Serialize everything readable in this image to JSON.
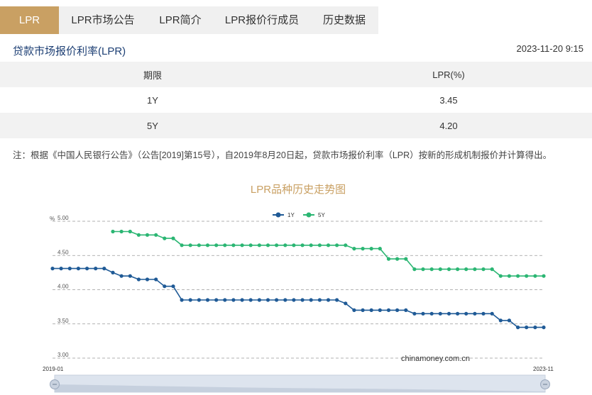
{
  "tabs": [
    {
      "label": "LPR",
      "active": true
    },
    {
      "label": "LPR市场公告",
      "active": false
    },
    {
      "label": "LPR简介",
      "active": false
    },
    {
      "label": "LPR报价行成员",
      "active": false
    },
    {
      "label": "历史数据",
      "active": false
    }
  ],
  "section_title": "贷款市场报价利率(LPR)",
  "timestamp": "2023-11-20 9:15",
  "table": {
    "headers": [
      "期限",
      "LPR(%)"
    ],
    "rows": [
      {
        "term": "1Y",
        "rate": "3.45"
      },
      {
        "term": "5Y",
        "rate": "4.20"
      }
    ]
  },
  "note": "注：根据《中国人民银行公告》（公告[2019]第15号），自2019年8月20日起，贷款市场报价利率（LPR）按新的形成机制报价并计算得出。",
  "colors": {
    "accent": "#c9a063",
    "title_blue": "#1d3f74",
    "series_1y": "#1f5a96",
    "series_5y": "#2bb673"
  },
  "chart_data": {
    "type": "line",
    "title": "LPR品种历史走势图",
    "ylabel": "%",
    "ylim": [
      3.0,
      5.0
    ],
    "yticks": [
      "5.00",
      "4.50",
      "4.00",
      "3.50",
      "3.00"
    ],
    "x_start_label": "2019-01",
    "x_end_label": "2023-11",
    "watermark": "chinamoney.com.cn",
    "legend_position": "top-center",
    "grid": true,
    "series": [
      {
        "name": "1Y",
        "values": [
          4.31,
          4.31,
          4.31,
          4.31,
          4.31,
          4.31,
          4.31,
          4.25,
          4.2,
          4.2,
          4.15,
          4.15,
          4.15,
          4.05,
          4.05,
          3.85,
          3.85,
          3.85,
          3.85,
          3.85,
          3.85,
          3.85,
          3.85,
          3.85,
          3.85,
          3.85,
          3.85,
          3.85,
          3.85,
          3.85,
          3.85,
          3.85,
          3.85,
          3.85,
          3.8,
          3.7,
          3.7,
          3.7,
          3.7,
          3.7,
          3.7,
          3.7,
          3.65,
          3.65,
          3.65,
          3.65,
          3.65,
          3.65,
          3.65,
          3.65,
          3.65,
          3.65,
          3.55,
          3.55,
          3.45,
          3.45,
          3.45,
          3.45
        ]
      },
      {
        "name": "5Y",
        "values": [
          null,
          null,
          null,
          null,
          null,
          null,
          null,
          4.85,
          4.85,
          4.85,
          4.8,
          4.8,
          4.8,
          4.75,
          4.75,
          4.65,
          4.65,
          4.65,
          4.65,
          4.65,
          4.65,
          4.65,
          4.65,
          4.65,
          4.65,
          4.65,
          4.65,
          4.65,
          4.65,
          4.65,
          4.65,
          4.65,
          4.65,
          4.65,
          4.65,
          4.6,
          4.6,
          4.6,
          4.6,
          4.45,
          4.45,
          4.45,
          4.3,
          4.3,
          4.3,
          4.3,
          4.3,
          4.3,
          4.3,
          4.3,
          4.3,
          4.3,
          4.2,
          4.2,
          4.2,
          4.2,
          4.2,
          4.2
        ]
      }
    ]
  }
}
